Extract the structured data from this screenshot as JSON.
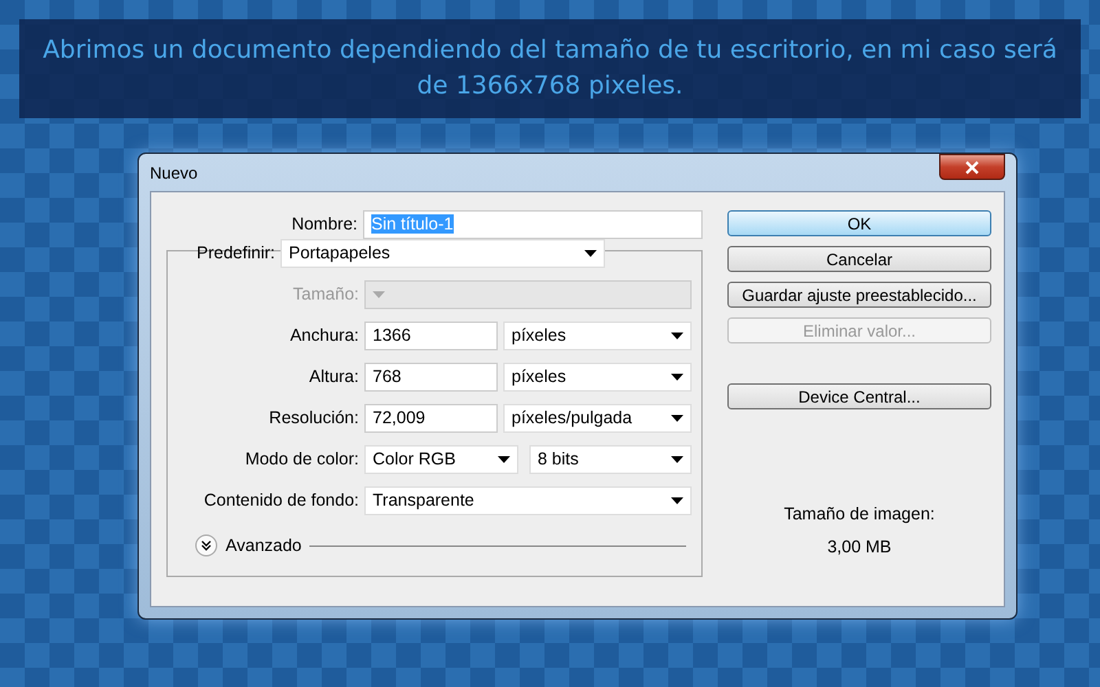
{
  "caption": "Abrimos un documento dependiendo del tamaño de tu escritorio, en mi caso será de 1366x768 pixeles.",
  "window": {
    "title": "Nuevo"
  },
  "name_field": {
    "label": "Nombre:",
    "value": "Sin título-1",
    "highlighted": true
  },
  "preset": {
    "label": "Predefinir:",
    "value": "Portapapeles"
  },
  "rows": [
    {
      "kind": "select",
      "label": "Tamaño:",
      "disabled": true
    },
    {
      "kind": "unit",
      "label": "Anchura:",
      "value": "1366",
      "unit": "píxeles",
      "disabled": false
    },
    {
      "kind": "unit",
      "label": "Altura:",
      "value": "768",
      "unit": "píxeles",
      "disabled": false
    },
    {
      "kind": "unit",
      "label": "Resolución:",
      "value": "72,009",
      "unit": "píxeles/pulgada",
      "disabled": false
    },
    {
      "kind": "pair",
      "label": "Modo de color:",
      "value": "Color RGB",
      "unit": "8 bits",
      "disabled": false
    },
    {
      "kind": "select",
      "label": "Contenido de fondo:",
      "value": "Transparente",
      "disabled": false
    }
  ],
  "advanced": {
    "label": "Avanzado",
    "expanded": false
  },
  "buttons": [
    {
      "label": "OK",
      "default": true,
      "disabled": false,
      "separated": false
    },
    {
      "label": "Cancelar",
      "default": false,
      "disabled": false,
      "separated": false
    },
    {
      "label": "Guardar ajuste preestablecido...",
      "default": false,
      "disabled": false,
      "separated": false
    },
    {
      "label": "Eliminar valor...",
      "default": false,
      "disabled": true,
      "separated": false
    },
    {
      "label": "Device Central...",
      "default": false,
      "disabled": false,
      "separated": true
    }
  ],
  "image_size": {
    "label": "Tamaño de imagen:",
    "value": "3,00 MB"
  }
}
